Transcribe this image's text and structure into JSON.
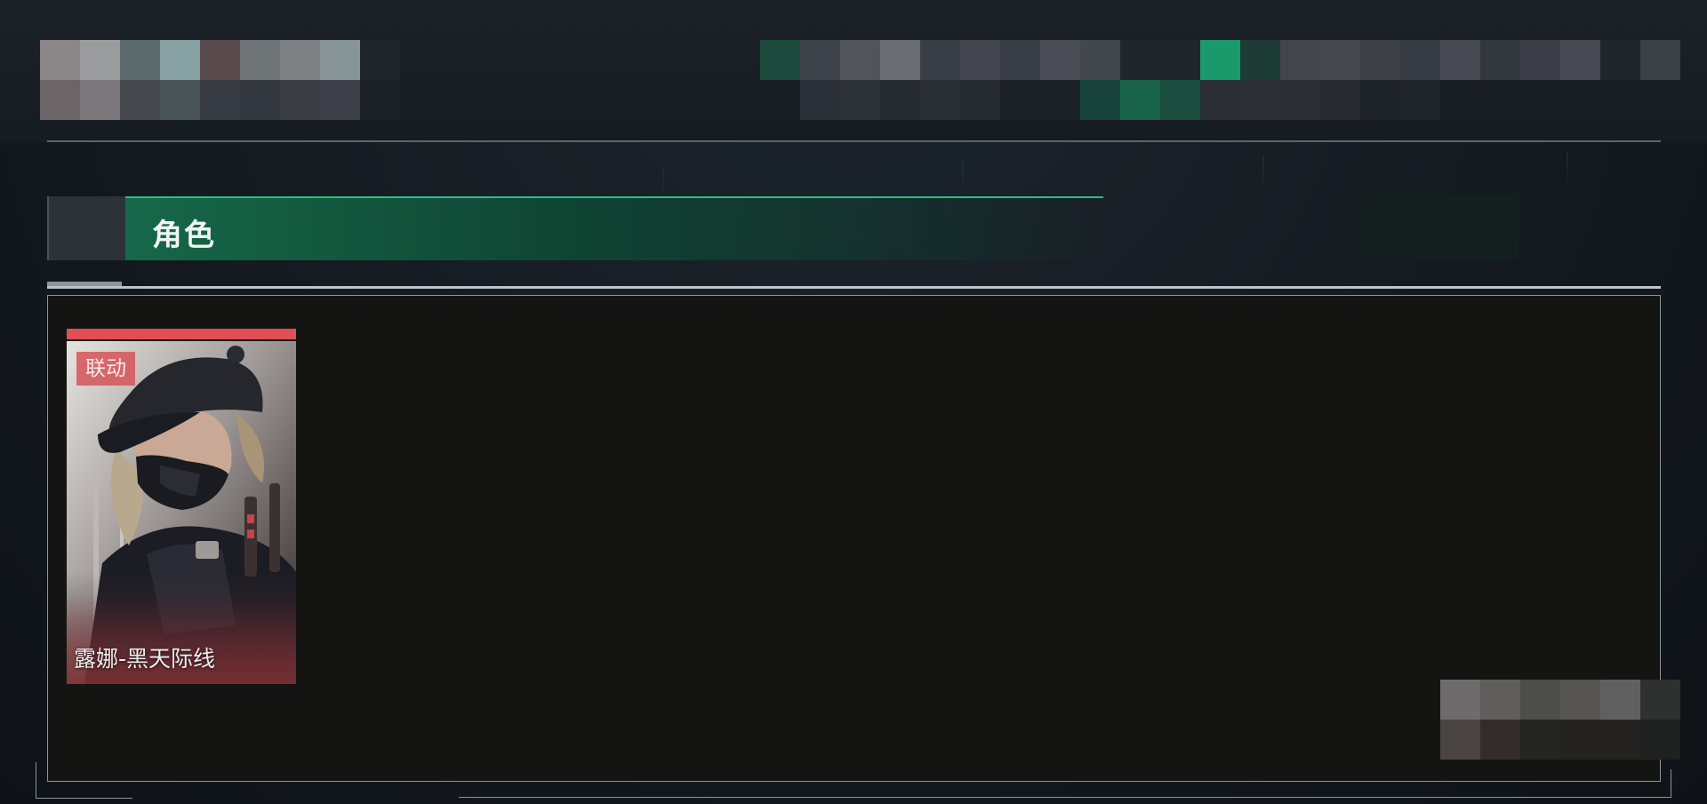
{
  "section": {
    "title": "角色"
  },
  "characters": [
    {
      "badge": "联动",
      "name": "露娜-黑天际线",
      "rarity_color": "#e14e55"
    }
  ],
  "colors": {
    "accent": "#1e9a6a",
    "panel_bg": "#141513",
    "rarity_red": "#e14e55"
  }
}
